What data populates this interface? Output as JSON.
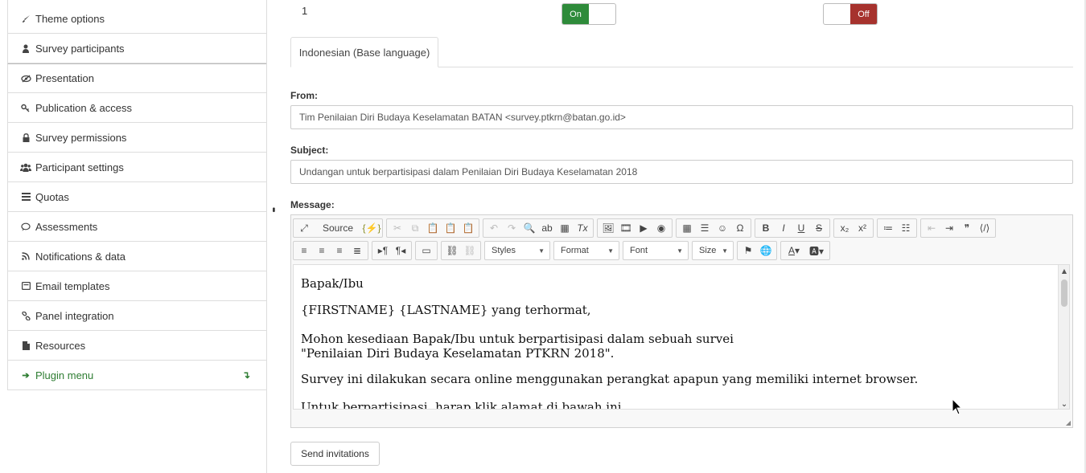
{
  "sidebar": {
    "items": [
      {
        "label": "Theme options",
        "icon": "brush-icon"
      },
      {
        "label": "Survey participants",
        "icon": "user-icon"
      },
      {
        "label": "Presentation",
        "icon": "eye-slash-icon"
      },
      {
        "label": "Publication & access",
        "icon": "key-icon"
      },
      {
        "label": "Survey permissions",
        "icon": "lock-icon"
      },
      {
        "label": "Participant settings",
        "icon": "users-icon"
      },
      {
        "label": "Quotas",
        "icon": "list-icon"
      },
      {
        "label": "Assessments",
        "icon": "comment-icon"
      },
      {
        "label": "Notifications & data",
        "icon": "rss-icon"
      },
      {
        "label": "Email templates",
        "icon": "envelope-icon"
      },
      {
        "label": "Panel integration",
        "icon": "link-icon"
      },
      {
        "label": "Resources",
        "icon": "file-icon"
      },
      {
        "label": "Plugin menu",
        "icon": "arrow-right-icon"
      }
    ]
  },
  "top_row": {
    "number": "1",
    "toggle1": {
      "on": "On",
      "state": "on"
    },
    "toggle2": {
      "off": "Off",
      "state": "off"
    }
  },
  "tab": {
    "label": "Indonesian (Base language)"
  },
  "form": {
    "from_label": "From:",
    "from_value": "Tim Penilaian Diri Budaya Keselamatan BATAN <survey.ptkrn@batan.go.id>",
    "subject_label": "Subject:",
    "subject_value": "Undangan untuk berpartisipasi dalam Penilaian Diri Budaya Keselamatan 2018",
    "message_label": "Message:"
  },
  "editor": {
    "source_label": "Source",
    "styles": "Styles",
    "format": "Format",
    "font": "Font",
    "size": "Size",
    "content": [
      "Bapak/Ibu",
      "{FIRSTNAME} {LASTNAME} yang terhormat,",
      "Mohon kesediaan Bapak/Ibu untuk berpartisipasi dalam sebuah survei",
      "\"Penilaian Diri Budaya Keselamatan PTKRN 2018\".",
      "Survey ini dilakukan secara online  menggunakan perangkat apapun yang memiliki internet browser.",
      "Untuk berpartisipasi, harap klik alamat di bawah ini."
    ]
  },
  "send_button": "Send invitations",
  "colors": {
    "on_green": "#2e8b3a",
    "off_red": "#a6322d",
    "plugin_green": "#2e7d32"
  }
}
